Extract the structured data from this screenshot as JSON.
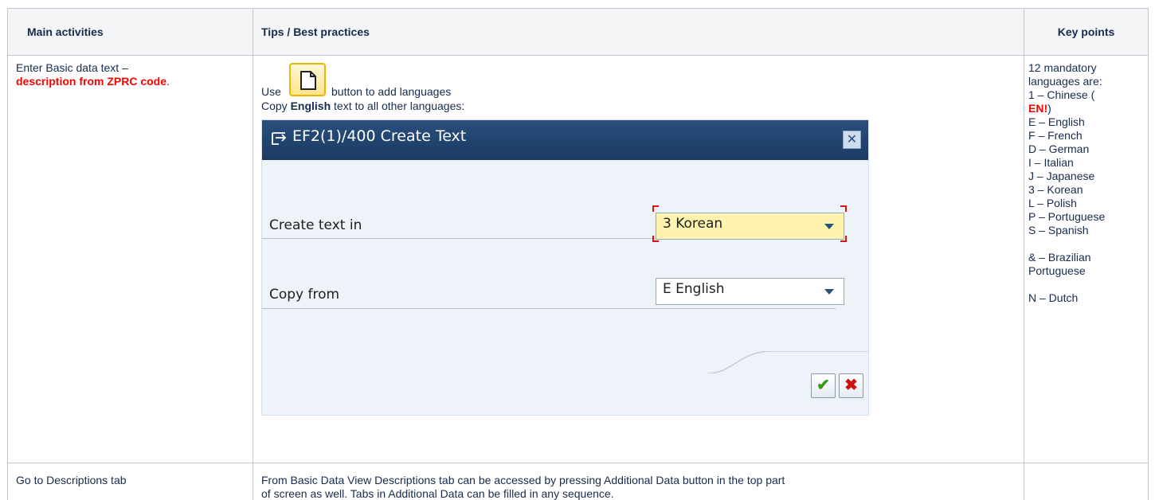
{
  "headers": {
    "main": "Main activities",
    "tips": "Tips / Best practices",
    "key": "Key points"
  },
  "row1": {
    "main_text": "Enter Basic data text –",
    "main_red": "description from ZPRC code",
    "main_dot": ".",
    "use_word": "Use",
    "use_rest": "button to add languages",
    "copy_prefix": "Copy ",
    "copy_bold": "English",
    "copy_rest": " text to all other languages:",
    "key": {
      "intro1": "12 mandatory",
      "intro2": "languages are:",
      "chinese": "1 – Chinese (",
      "chinese_en": "EN!",
      "chinese_close": ")",
      "langs": [
        "E – English",
        "F – French",
        "D – German",
        "I – Italian",
        "J – Japanese",
        "3 – Korean",
        "L – Polish",
        "P – Portuguese",
        "S – Spanish"
      ],
      "brazil1": "& – Brazilian",
      "brazil2": "Portuguese",
      "dutch": "N – Dutch"
    }
  },
  "dialog": {
    "title": "EF2(1)/400 Create Text",
    "create_label": "Create text in",
    "create_value": "3 Korean",
    "copy_label": "Copy from",
    "copy_value": "E English",
    "ok_glyph": "✔",
    "cancel_glyph": "✖",
    "close_glyph": "✕"
  },
  "row2": {
    "main": "Go to Descriptions tab",
    "tips1": "From Basic Data View Descriptions tab can be accessed by pressing Additional Data button in the top part",
    "tips2": "of screen as well. Tabs in Additional Data can be filled in any sequence."
  },
  "colors": {
    "header_bg": "#f4f5f7",
    "border": "#c1c7d0",
    "red": "#ff0000",
    "dialog_title": "#1f4470",
    "highlight": "#fff3b0"
  },
  "icons": [
    "new-document-icon",
    "dialog-window-icon",
    "close-icon",
    "dropdown-arrow-icon",
    "checkmark-icon",
    "cancel-x-icon"
  ]
}
